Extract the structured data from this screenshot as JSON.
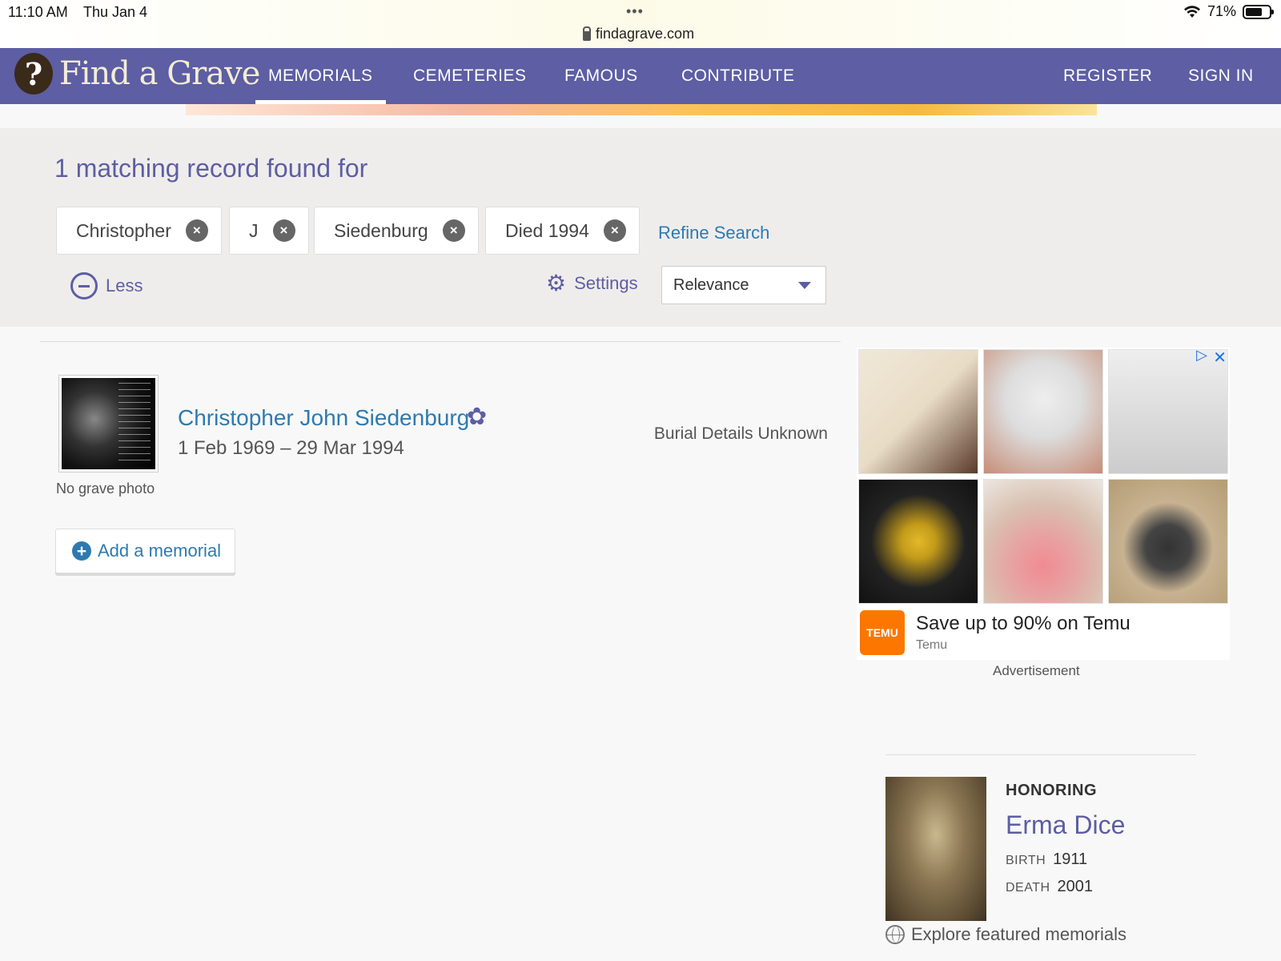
{
  "status_bar": {
    "time": "11:10 AM",
    "date": "Thu Jan 4",
    "url": "findagrave.com",
    "battery": "71%",
    "battery_level": 0.71
  },
  "nav": {
    "logo_text": "Find a Grave",
    "logo_mark": "?",
    "items": [
      {
        "label": "MEMORIALS"
      },
      {
        "label": "CEMETERIES"
      },
      {
        "label": "FAMOUS"
      },
      {
        "label": "CONTRIBUTE"
      }
    ],
    "register": "REGISTER",
    "sign_in": "SIGN IN"
  },
  "search": {
    "heading": "1 matching record found for",
    "chips": [
      {
        "label": "Christopher"
      },
      {
        "label": "J"
      },
      {
        "label": "Siedenburg"
      },
      {
        "label": "Died 1994"
      }
    ],
    "chip_remove_glyph": "×",
    "refine": "Refine Search",
    "less": "Less",
    "settings": "Settings",
    "sort": "Relevance"
  },
  "result": {
    "name": "Christopher John Siedenburg",
    "dates": "1 Feb 1969 – 29 Mar 1994",
    "burial": "Burial Details Unknown",
    "no_photo": "No grave photo",
    "add_memorial": "Add a memorial"
  },
  "ad": {
    "title": "Save up to 90% on Temu",
    "brand": "Temu",
    "logo_text": "TEMU",
    "label": "Advertisement"
  },
  "honoring": {
    "label": "HONORING",
    "name": "Erma Dice",
    "birth_label": "BIRTH",
    "birth": "1911",
    "death_label": "DEATH",
    "death": "2001",
    "explore": "Explore featured memorials"
  }
}
